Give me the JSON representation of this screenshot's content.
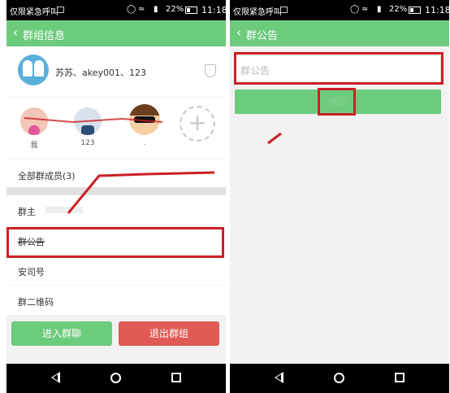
{
  "status_bar": {
    "carrier": "仅限紧急呼叫",
    "battery": "22%",
    "time": "11:18"
  },
  "left_screen": {
    "title": "群组信息",
    "group_name": "苏苏、akey001、123",
    "members": [
      {
        "label": "我"
      },
      {
        "label": "123"
      },
      {
        "label": "."
      }
    ],
    "rows": {
      "all_members": "全部群成员(3)",
      "owner": "群主",
      "notice": "群公告",
      "id": "安司号",
      "qr": "群二维码"
    },
    "buttons": {
      "enter": "进入群聊",
      "exit": "退出群组"
    }
  },
  "right_screen": {
    "title": "群公告",
    "input_placeholder": "群公告",
    "confirm_label": "确定"
  },
  "colors": {
    "accent": "#6dcb7c",
    "danger": "#e05b55",
    "highlight": "#cc1f24"
  }
}
